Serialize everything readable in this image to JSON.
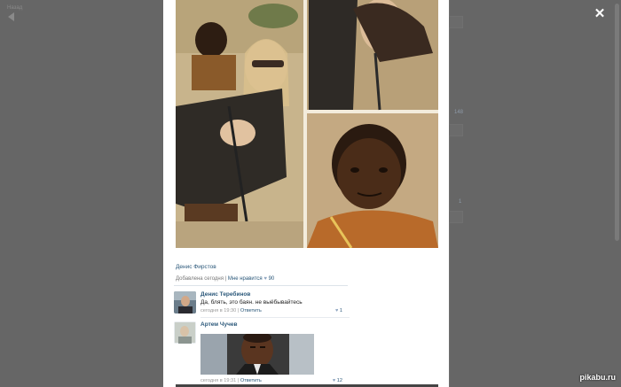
{
  "background": {
    "back_label": "Назад",
    "counts": [
      "148",
      "1"
    ]
  },
  "photo_post": {
    "author": "Денис Фирстов",
    "added_label": "Добавлена сегодня",
    "like_label": "Мне нравится",
    "like_count": "90"
  },
  "comments": [
    {
      "author": "Денис Теребинов",
      "text": "Да, блять, это баян. не выёбывайтесь",
      "time": "сегодня в 19:30",
      "reply_label": "Ответить",
      "likes": "1"
    },
    {
      "author": "Артем Чучев",
      "text": "",
      "time": "сегодня в 19:31",
      "reply_label": "Ответить",
      "likes": "12"
    }
  ],
  "separator": "|",
  "watermark": "pikabu.ru",
  "colors": {
    "link": "#2b587a",
    "overlay": "#5b5b5b",
    "heart": "#8ea5c0"
  },
  "icons": [
    "close-icon",
    "back-arrow-icon",
    "heart-icon"
  ]
}
